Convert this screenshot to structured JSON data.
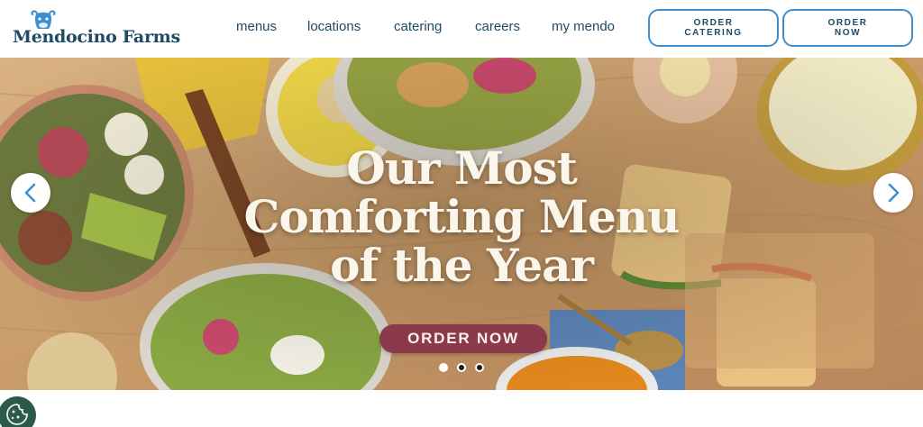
{
  "brand": {
    "name": "Mendocino Farms",
    "logo_icon": "cow-icon"
  },
  "nav": {
    "items": [
      {
        "label": "menus"
      },
      {
        "label": "locations"
      },
      {
        "label": "catering"
      },
      {
        "label": "careers"
      },
      {
        "label": "my mendo"
      }
    ]
  },
  "actions": {
    "order_catering_line1": "ORDER",
    "order_catering_line2": "CATERING",
    "order_now_line1": "ORDER",
    "order_now_line2": "NOW"
  },
  "hero": {
    "headline_line1": "Our Most",
    "headline_line2": "Comforting Menu",
    "headline_line3": "of the Year",
    "cta_label": "ORDER NOW",
    "prev_icon": "chevron-left-icon",
    "next_icon": "chevron-right-icon",
    "slide_count": 3,
    "active_slide": 1
  },
  "cookie": {
    "icon": "cookie-icon"
  },
  "colors": {
    "brand_navy": "#1e4a63",
    "button_border": "#3d8fcf",
    "cta_plum": "#8a3a4c",
    "arrow_blue": "#3d8fcf",
    "cookie_green": "#2c5a48"
  }
}
